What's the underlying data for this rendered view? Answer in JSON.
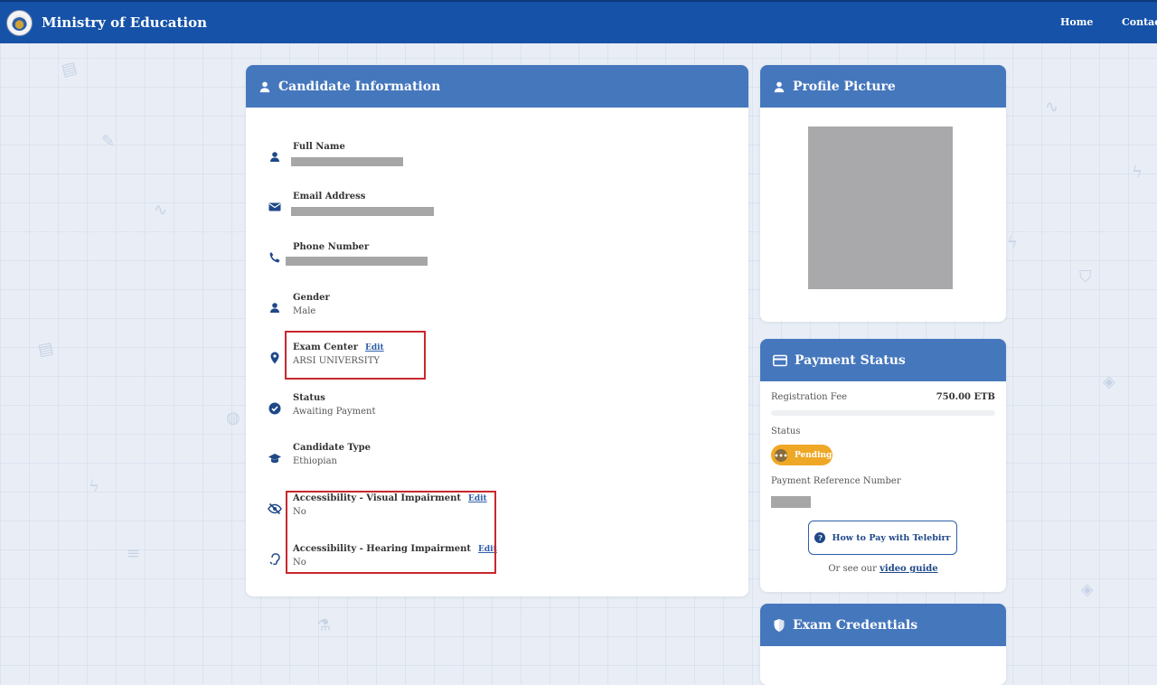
{
  "header": {
    "brand": "Ministry of Education",
    "nav": {
      "home": "Home",
      "contact": "Contact"
    }
  },
  "candidate": {
    "title": "Candidate Information",
    "fields": {
      "full_name": {
        "label": "Full Name"
      },
      "email": {
        "label": "Email Address"
      },
      "phone": {
        "label": "Phone Number"
      },
      "gender": {
        "label": "Gender",
        "value": "Male"
      },
      "exam_center": {
        "label": "Exam Center",
        "value": "ARSI UNIVERSITY",
        "edit": "Edit"
      },
      "status": {
        "label": "Status",
        "value": "Awaiting Payment"
      },
      "candidate_type": {
        "label": "Candidate Type",
        "value": "Ethiopian"
      },
      "visual": {
        "label": "Accessibility - Visual Impairment",
        "value": "No",
        "edit": "Edit"
      },
      "hearing": {
        "label": "Accessibility - Hearing Impairment",
        "value": "No",
        "edit": "Edit"
      }
    }
  },
  "profile": {
    "title": "Profile Picture"
  },
  "payment": {
    "title": "Payment Status",
    "fee_label": "Registration Fee",
    "fee_value": "750.00 ETB",
    "status_label": "Status",
    "status_value": "Pending",
    "ref_label": "Payment Reference Number",
    "how_button": "How to Pay with Telebirr",
    "guide_prefix": "Or see our",
    "guide_link": "video guide"
  },
  "credentials": {
    "title": "Exam Credentials"
  },
  "colors": {
    "header": "#1552a8",
    "card_head": "#4577bd",
    "highlight": "#c8282e",
    "pending": "#efa825"
  }
}
